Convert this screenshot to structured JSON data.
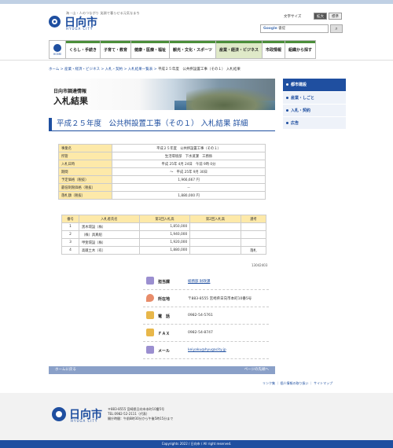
{
  "header": {
    "tagline": "海・山・人のつながり 笑顔で暮らせる元気なまち",
    "logo_text": "日向市",
    "logo_sub": "HYUGA CITY",
    "font_size_label": "文字サイズ",
    "enlarge": "拡大",
    "standard": "標準",
    "search_brand": "Google",
    "search_placeholder": "書提",
    "search_icon": "magnifier-icon"
  },
  "nav": {
    "home": "HOME",
    "items": [
      "くらし・手続き",
      "子育て・教育",
      "健康・医療・福祉",
      "観光・文化・スポーツ",
      "産業・経済・ビジネス",
      "市政情報",
      "組織から探す"
    ]
  },
  "breadcrumb": {
    "items": [
      "ホーム",
      "産業・経済・ビジネス",
      "入札・契約",
      "入札結果一覧表"
    ],
    "current": "平成２５年度　公共桝設置工事（その１） 入札結果"
  },
  "banner": {
    "sub": "日向市調達情報",
    "main": "入札結果"
  },
  "page_title": "平成２５年度　公共桝設置工事（その１） 入札結果 詳細",
  "info_rows": [
    {
      "label": "事業名",
      "value": "平成２５年度　公共桝設置工事（その１）"
    },
    {
      "label": "所管",
      "value": "生活環境部　下水道課　工務係"
    },
    {
      "label": "入札日時",
      "value": "平成 25年 4月 24日　午前 9時 0分"
    },
    {
      "label": "期間",
      "value": "～　平成 25年 9月 30日"
    },
    {
      "label": "予定価格（税抜）",
      "value": "1,966,667 円"
    },
    {
      "label": "最低制限価格（税抜）",
      "value": "－"
    },
    {
      "label": "落札額（税抜）",
      "value": "1,880,000 円"
    }
  ],
  "bid_table": {
    "headers": [
      "番号",
      "入札者氏名",
      "第1回入札高",
      "第2回入札高",
      "選考"
    ],
    "rows": [
      {
        "no": "1",
        "name": "黒木環設（株）",
        "r1": "1,850,000",
        "r2": "",
        "sel": ""
      },
      {
        "no": "2",
        "name": "（株）具真組",
        "r1": "1,940,000",
        "r2": "",
        "sel": ""
      },
      {
        "no": "3",
        "name": "甲斐環設（株）",
        "r1": "1,920,000",
        "r2": "",
        "sel": ""
      },
      {
        "no": "4",
        "name": "高蔵土木（有）",
        "r1": "1,880,000",
        "r2": "",
        "sel": "落札"
      }
    ]
  },
  "page_id": "13042403",
  "contact": {
    "dept_label": "担当課",
    "dept_value": "総務部 財政課",
    "addr_label": "所在地",
    "addr_value": "〒883-8555 宮崎県日向市本町10番5号",
    "tel_label": "電　話",
    "tel_value": "0982-54-5761",
    "fax_label": "ＦＡＸ",
    "fax_value": "0982-54-8747",
    "mail_label": "メール",
    "mail_value": "keiyaku@hyugacity.jp"
  },
  "pagebar": {
    "left": "ホームに戻る",
    "right": "ページの先頭へ"
  },
  "sidebar": {
    "header": "都市建設",
    "items": [
      "産業・しごと",
      "入札・契約",
      "広告"
    ]
  },
  "footer": {
    "links": "リンク集 ｜ 個人情報の取り扱い ｜ サイトマップ",
    "logo_text": "日向市",
    "logo_sub": "HYUGA CITY",
    "addr1": "〒883-8555 宮崎県日向市本町10番5号",
    "addr2": "TEL:0982-52-2111（代表）",
    "addr3": "開庁時間：午前8時30分から午後5時15分まで",
    "copyright": "Copyrights 2022 / 日向市 / All right reserved."
  },
  "colors": {
    "brand": "#1f4fa0",
    "table_header": "#fde9a9",
    "nav_active": "#dfe9c8"
  }
}
